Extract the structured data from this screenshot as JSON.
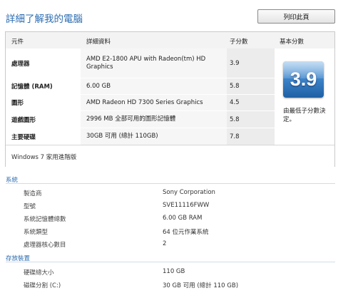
{
  "page": {
    "title": "詳細了解我的電腦",
    "print_button": "列印此頁"
  },
  "score_table": {
    "headers": {
      "component": "元件",
      "details": "詳細資料",
      "subscore": "子分數",
      "base_score": "基本分數"
    },
    "rows": [
      {
        "component": "處理器",
        "details": "AMD E2-1800 APU with Radeon(tm) HD Graphics",
        "subscore": "3.9"
      },
      {
        "component": "記憶體 (RAM)",
        "details": "6.00 GB",
        "subscore": "5.8"
      },
      {
        "component": "圖形",
        "details": "AMD Radeon HD 7300 Series Graphics",
        "subscore": "4.5"
      },
      {
        "component": "遊戲圖形",
        "details": "2996 MB 全部可用的圖形記憶體",
        "subscore": "5.8"
      },
      {
        "component": "主要硬碟",
        "details": "30GB 可用 (總計 110GB)",
        "subscore": "7.8"
      }
    ],
    "base_score": "3.9",
    "base_score_note": "由最低子分數決定。",
    "edition": "Windows 7 家用進階版"
  },
  "system": {
    "title": "系統",
    "items": [
      {
        "label": "製造商",
        "value": "Sony Corporation"
      },
      {
        "label": "型號",
        "value": "SVE11116FWW"
      },
      {
        "label": "系統記憶體總數",
        "value": "6.00 GB RAM"
      },
      {
        "label": "系統類型",
        "value": "64 位元作業系統"
      },
      {
        "label": "處理器核心數目",
        "value": "2"
      }
    ]
  },
  "storage": {
    "title": "存放裝置",
    "items": [
      {
        "label": "硬碟總大小",
        "value": "110 GB"
      },
      {
        "label": "磁碟分割 (C:)",
        "value": "30 GB 可用 (總計 110 GB)"
      }
    ]
  }
}
